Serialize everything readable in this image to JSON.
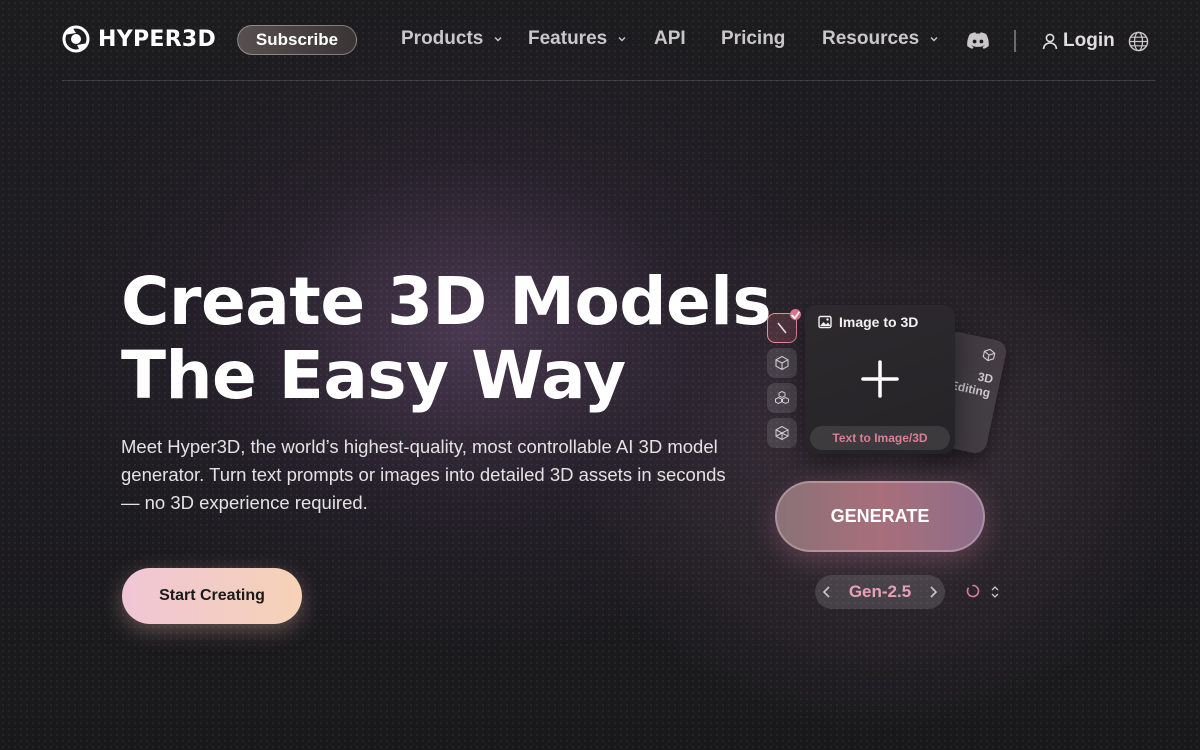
{
  "header": {
    "logo_text": "HYPER3D",
    "subscribe_label": "Subscribe",
    "nav": [
      {
        "label": "Products",
        "has_dropdown": true
      },
      {
        "label": "Features",
        "has_dropdown": true
      },
      {
        "label": "API",
        "has_dropdown": false
      },
      {
        "label": "Pricing",
        "has_dropdown": false
      },
      {
        "label": "Resources",
        "has_dropdown": true
      }
    ],
    "discord_icon": "discord-icon",
    "login_label": "Login",
    "language_icon": "globe-icon"
  },
  "hero": {
    "title_line1": "Create 3D Models",
    "title_line2": "The Easy Way",
    "description": "Meet Hyper3D, the world’s highest-quality, most controllable AI 3D model generator. Turn text prompts or images into detailed 3D assets in seconds — no 3D experience required.",
    "cta_label": "Start Creating"
  },
  "widget": {
    "tools": [
      "pen-icon",
      "cube-icon",
      "cubes-icon",
      "wireframe-cube-icon"
    ],
    "card_title": "Image to 3D",
    "card_switch_label": "Text to Image/3D",
    "back_card_label": "3D Editing",
    "generate_label": "GENERATE",
    "model_version": "Gen-2.5"
  },
  "colors": {
    "accent_pink": "#e27a93",
    "cta_gradient_start": "#f0c6d6",
    "cta_gradient_end": "#f6d2b6",
    "background": "#1a1a1c"
  }
}
